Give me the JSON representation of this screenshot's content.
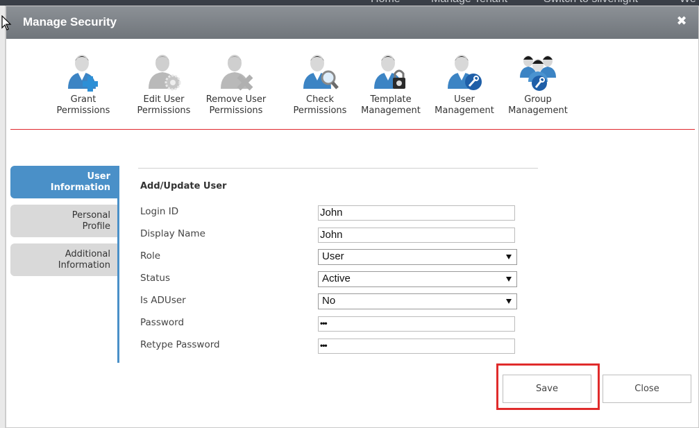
{
  "background_nav": {
    "items": [
      "Home",
      "Manage Tenant",
      "Switch to silverlight",
      "We"
    ]
  },
  "dialog": {
    "title": "Manage Security",
    "close_glyph": "✖"
  },
  "toolbar": {
    "items": [
      {
        "line1": "Grant",
        "line2": "Permissions",
        "icon": "user-plus-icon"
      },
      {
        "line1": "Edit User",
        "line2": "Permissions",
        "icon": "user-gear-icon"
      },
      {
        "line1": "Remove User",
        "line2": "Permissions",
        "icon": "user-remove-icon"
      },
      {
        "line1": "Check",
        "line2": "Permissions",
        "icon": "user-search-icon"
      },
      {
        "line1": "Template",
        "line2": "Management",
        "icon": "user-lock-icon"
      },
      {
        "line1": "User",
        "line2": "Management",
        "icon": "user-wrench-icon"
      },
      {
        "line1": "Group",
        "line2": "Management",
        "icon": "group-wrench-icon"
      }
    ]
  },
  "side_tabs": [
    {
      "line1": "User",
      "line2": "Information",
      "active": true
    },
    {
      "line1": "Personal",
      "line2": "Profile",
      "active": false
    },
    {
      "line1": "Additional",
      "line2": "Information",
      "active": false
    }
  ],
  "form": {
    "heading": "Add/Update User",
    "login_id": {
      "label": "Login ID",
      "value": "John"
    },
    "display_name": {
      "label": "Display Name",
      "value": "John"
    },
    "role": {
      "label": "Role",
      "value": "User"
    },
    "status": {
      "label": "Status",
      "value": "Active"
    },
    "is_aduser": {
      "label": "Is ADUser",
      "value": "No"
    },
    "password": {
      "label": "Password",
      "value": "•••"
    },
    "retype_password": {
      "label": "Retype Password",
      "value": "•••"
    }
  },
  "buttons": {
    "save": "Save",
    "close": "Close"
  },
  "colors": {
    "accent_blue": "#4a90c8",
    "divider_red": "#e0262d",
    "highlight_red": "#e02b2b",
    "titlebar_gray": "#7d8287"
  }
}
